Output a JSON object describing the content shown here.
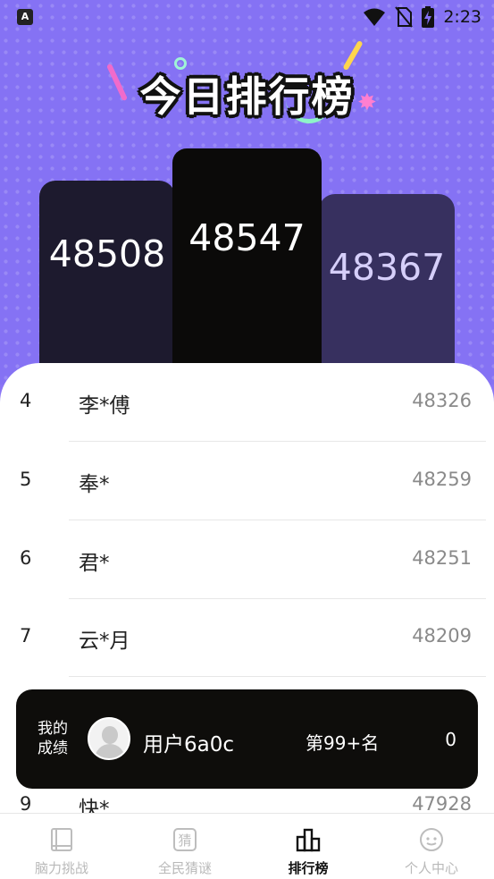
{
  "status_bar": {
    "app_icon": "A",
    "time": "2:23"
  },
  "page_title": "今日排行榜",
  "podium": {
    "first": {
      "score": "48547"
    },
    "second": {
      "score": "48508"
    },
    "third": {
      "score": "48367"
    }
  },
  "ranking": [
    {
      "rank": "4",
      "name": "李*傅",
      "score": "48326"
    },
    {
      "rank": "5",
      "name": "奉*",
      "score": "48259"
    },
    {
      "rank": "6",
      "name": "君*",
      "score": "48251"
    },
    {
      "rank": "7",
      "name": "云*月",
      "score": "48209"
    },
    {
      "rank": "9",
      "name": "快*",
      "score": "47928"
    }
  ],
  "my_score": {
    "label": "我的成绩",
    "username": "用户6a0c",
    "rank_text": "第99+名",
    "score": "0"
  },
  "tabs": [
    {
      "label": "脑力挑战",
      "icon": "book-icon",
      "active": false
    },
    {
      "label": "全民猜谜",
      "icon": "guess-icon",
      "active": false
    },
    {
      "label": "排行榜",
      "icon": "leaderboard-icon",
      "active": true
    },
    {
      "label": "个人中心",
      "icon": "profile-face-icon",
      "active": false
    }
  ],
  "tab_guess_glyph": "猜",
  "colors": {
    "hero_bg": "#8572f4",
    "podium_first": "#0b0a09",
    "podium_second": "#1d1a2e",
    "podium_third": "#37305f",
    "card_dark": "#0e0d0b"
  }
}
